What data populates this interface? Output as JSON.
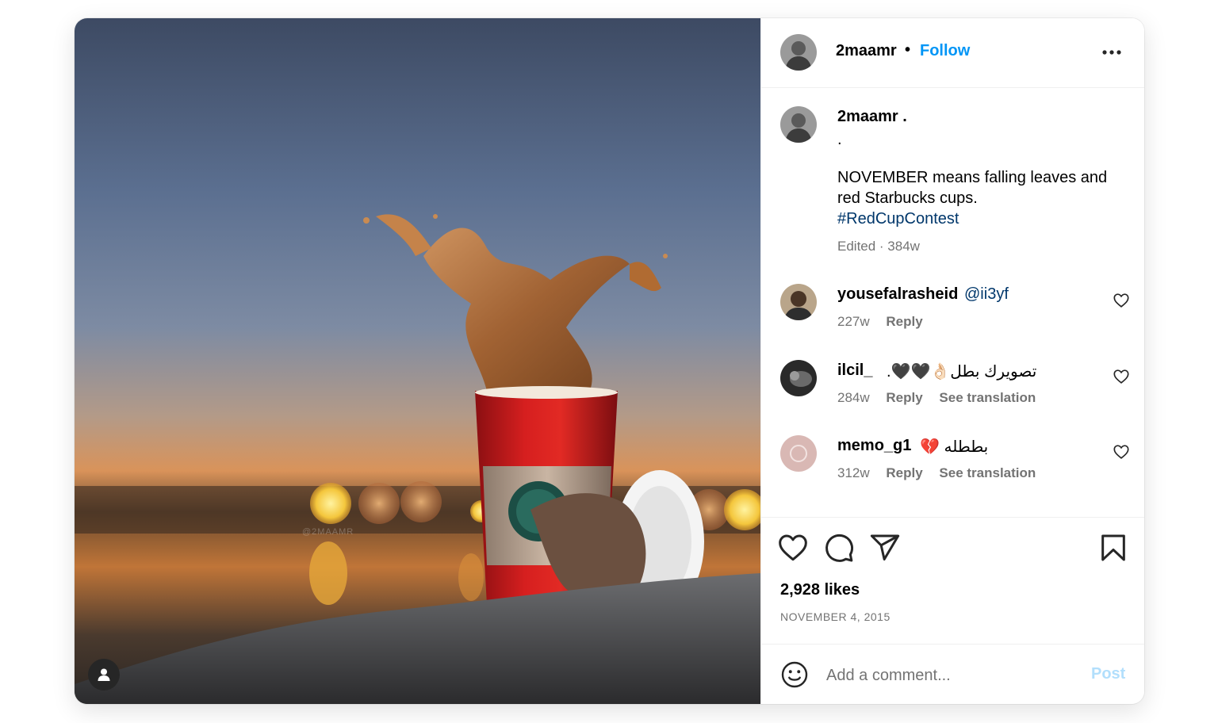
{
  "media": {
    "watermark": "@2MAAMR",
    "user_tag_icon": "user-icon"
  },
  "header": {
    "username": "2maamr",
    "separator": "•",
    "follow_label": "Follow",
    "more_icon": "more-horizontal-icon"
  },
  "caption": {
    "username": "2maamr .",
    "line_dot": ".",
    "text_line_1": "NOVEMBER means falling leaves and",
    "text_line_2": "red Starbucks cups.",
    "hashtag": "#RedCupContest",
    "meta": "Edited · 384w"
  },
  "comments": [
    {
      "username": "yousefalrasheid",
      "text": "",
      "mention": "@ii3yf",
      "time": "227w",
      "reply": "Reply",
      "see_translation": ""
    },
    {
      "username": "ilcil_",
      "text": ".🖤🖤👌🏻تصويرك بطل",
      "mention": "",
      "time": "284w",
      "reply": "Reply",
      "see_translation": "See translation"
    },
    {
      "username": "memo_g1",
      "text": "💔 بططله",
      "mention": "",
      "time": "312w",
      "reply": "Reply",
      "see_translation": "See translation"
    }
  ],
  "actions": {
    "like_icon": "heart-icon",
    "comment_icon": "comment-icon",
    "share_icon": "share-icon",
    "save_icon": "bookmark-icon",
    "likes": "2,928 likes",
    "date": "NOVEMBER 4, 2015"
  },
  "add_comment": {
    "emoji_icon": "emoji-icon",
    "placeholder": "Add a comment...",
    "post_label": "Post"
  },
  "colors": {
    "link": "#0095f6",
    "hashtag": "#00376b",
    "secondary_text": "#737373",
    "post_disabled": "#b2dffc"
  }
}
